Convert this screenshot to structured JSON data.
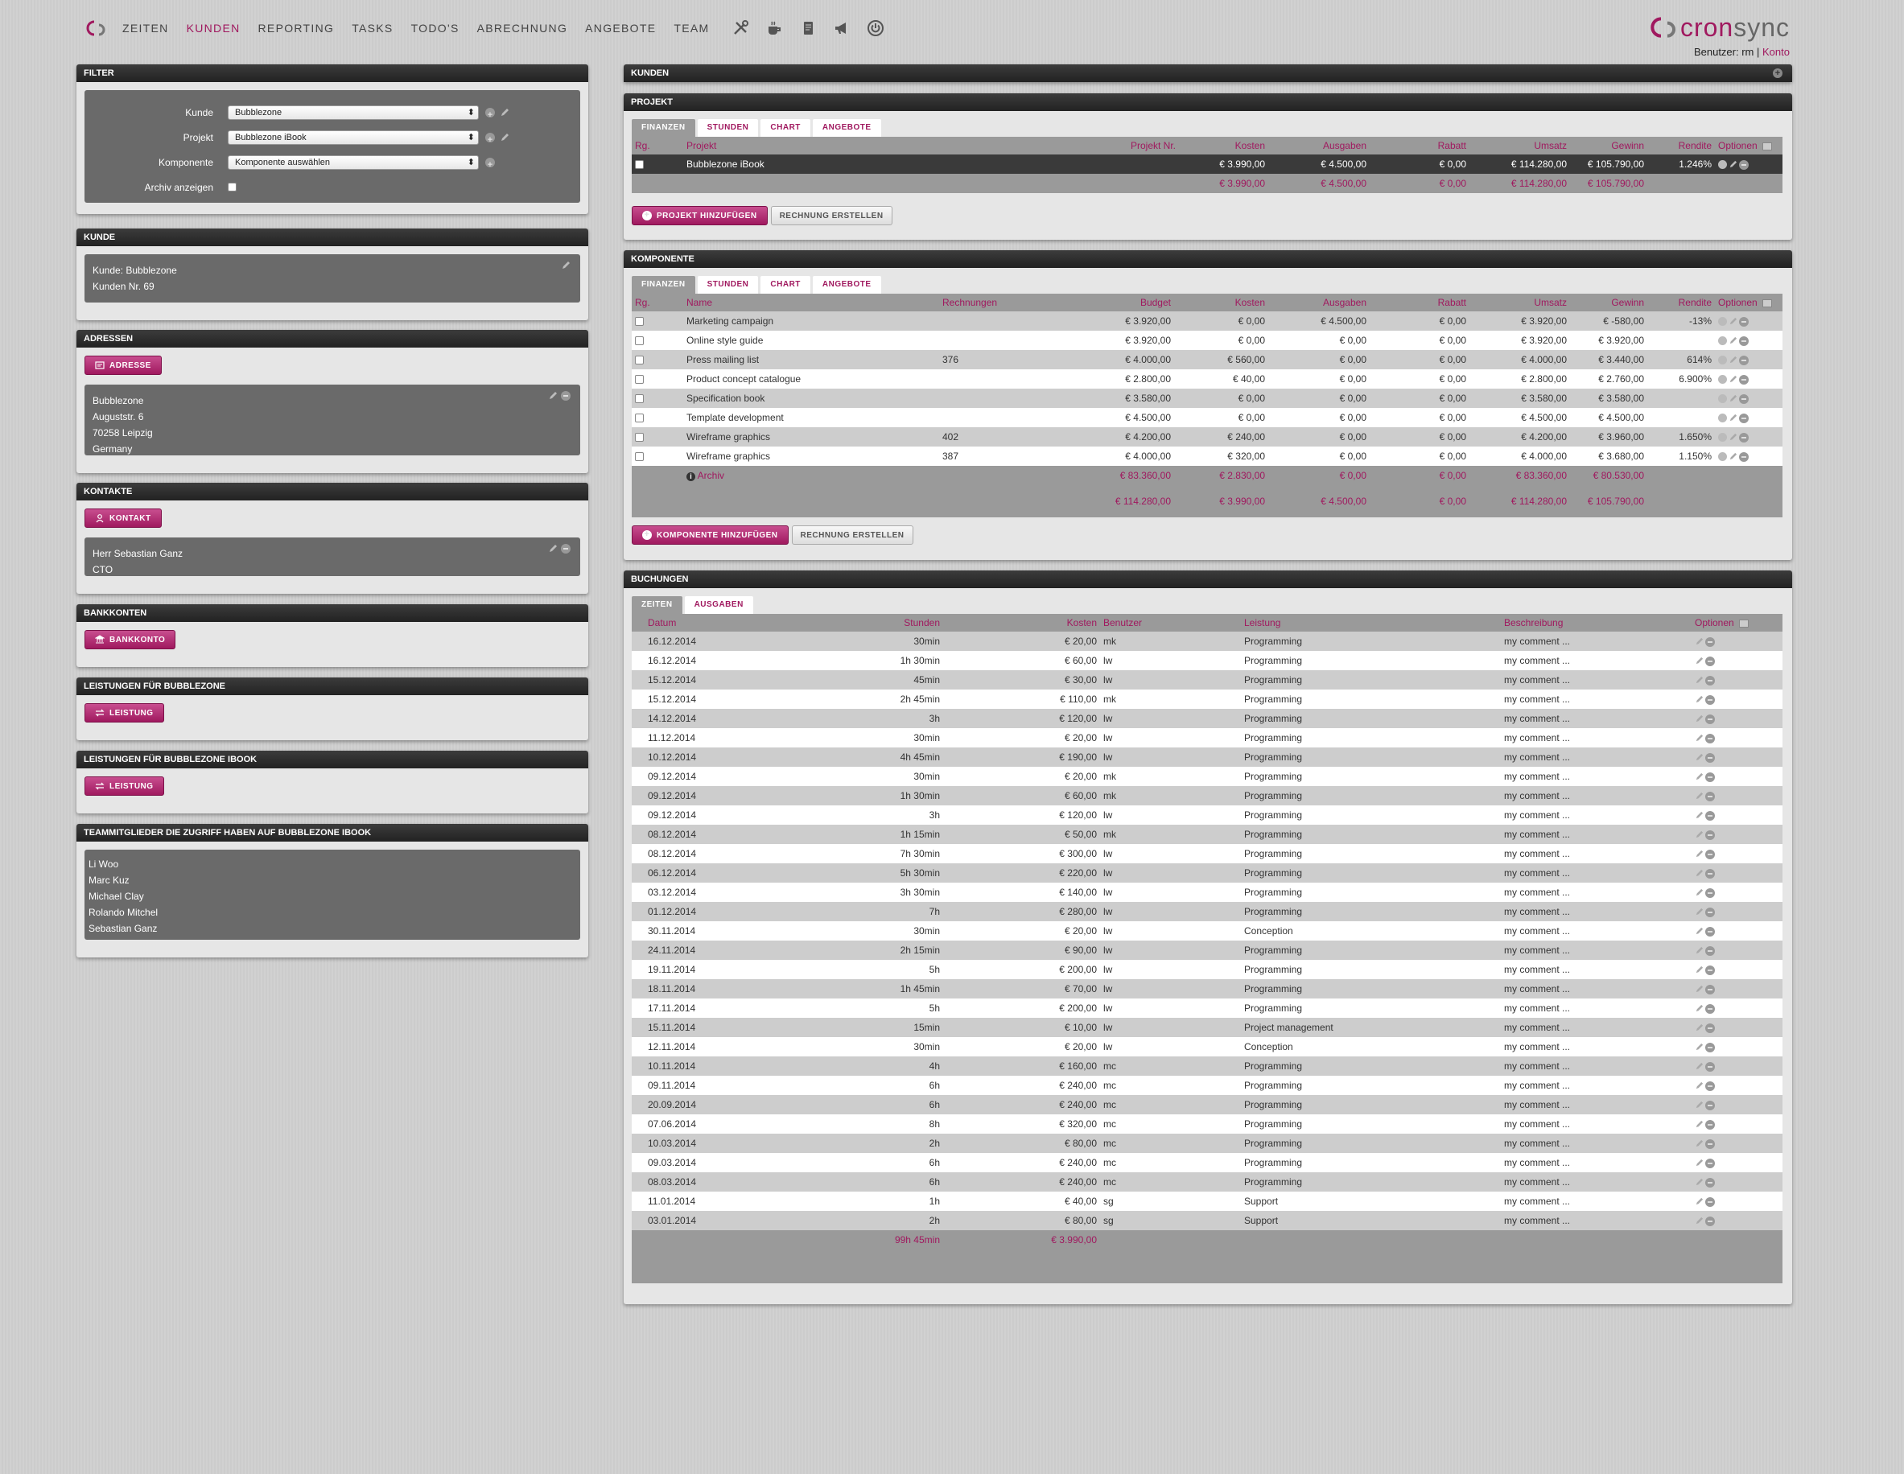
{
  "nav": {
    "items": [
      "ZEITEN",
      "KUNDEN",
      "REPORTING",
      "TASKS",
      "TODO'S",
      "ABRECHNUNG",
      "ANGEBOTE",
      "TEAM"
    ],
    "active": "KUNDEN",
    "icons": [
      "tools-icon",
      "coffee-icon",
      "document-icon",
      "megaphone-icon",
      "power-icon"
    ]
  },
  "brand": {
    "cron": "cron",
    "sync": "sync"
  },
  "user": {
    "label": "Benutzer: rm",
    "sep": "|",
    "account": "Konto"
  },
  "colors": {
    "accent": "#a0195f",
    "header": "#2c2c2c",
    "panel": "#e6e6e6"
  },
  "filter": {
    "title": "FILTER",
    "kunde_label": "Kunde",
    "kunde_value": "Bubblezone",
    "projekt_label": "Projekt",
    "projekt_value": "Bubblezone iBook",
    "komponente_label": "Komponente",
    "komponente_value": "Komponente auswählen",
    "archiv_label": "Archiv anzeigen"
  },
  "kunde": {
    "title": "KUNDE",
    "line1": "Kunde: Bubblezone",
    "line2": "Kunden Nr. 69"
  },
  "adressen": {
    "title": "ADRESSEN",
    "button": "ADRESSE",
    "lines": [
      "Bubblezone",
      "Auguststr. 6",
      "70258 Leipzig",
      "Germany"
    ]
  },
  "kontakte": {
    "title": "KONTAKTE",
    "button": "KONTAKT",
    "lines": [
      "Herr Sebastian Ganz",
      "CTO"
    ]
  },
  "bankkonten": {
    "title": "BANKKONTEN",
    "button": "BANKKONTO"
  },
  "leistungen1": {
    "title": "LEISTUNGEN FÜR BUBBLEZONE",
    "button": "LEISTUNG"
  },
  "leistungen2": {
    "title": "LEISTUNGEN FÜR BUBBLEZONE IBOOK",
    "button": "LEISTUNG"
  },
  "team": {
    "title": "TEAMMITGLIEDER DIE ZUGRIFF HABEN AUF BUBBLEZONE IBOOK",
    "members": [
      "Li Woo",
      "Marc Kuz",
      "Michael Clay",
      "Rolando Mitchel",
      "Sebastian Ganz"
    ]
  },
  "kunden_panel": {
    "title": "KUNDEN"
  },
  "projekt": {
    "title": "PROJEKT",
    "tabs": [
      "FINANZEN",
      "STUNDEN",
      "CHART",
      "ANGEBOTE"
    ],
    "headers": [
      "Rg.",
      "Projekt",
      "Projekt Nr.",
      "Kosten",
      "Ausgaben",
      "Rabatt",
      "Umsatz",
      "Gewinn",
      "Rendite",
      "Optionen"
    ],
    "row": {
      "name": "Bubblezone iBook",
      "nr": "",
      "kosten": "€ 3.990,00",
      "ausgaben": "€ 4.500,00",
      "rabatt": "€ 0,00",
      "umsatz": "€ 114.280,00",
      "gewinn": "€ 105.790,00",
      "rendite": "1.246%"
    },
    "sum": {
      "kosten": "€ 3.990,00",
      "ausgaben": "€ 4.500,00",
      "rabatt": "€ 0,00",
      "umsatz": "€ 114.280,00",
      "gewinn": "€ 105.790,00"
    },
    "add_button": "PROJEKT HINZUFÜGEN",
    "invoice_button": "RECHNUNG ERSTELLEN"
  },
  "komponente": {
    "title": "KOMPONENTE",
    "tabs": [
      "FINANZEN",
      "STUNDEN",
      "CHART",
      "ANGEBOTE"
    ],
    "headers": [
      "Rg.",
      "Name",
      "Rechnungen",
      "Budget",
      "Kosten",
      "Ausgaben",
      "Rabatt",
      "Umsatz",
      "Gewinn",
      "Rendite",
      "Optionen"
    ],
    "rows": [
      {
        "name": "Marketing campaign",
        "rech": "",
        "budget": "€ 3.920,00",
        "kosten": "€ 0,00",
        "ausgaben": "€ 4.500,00",
        "rabatt": "€ 0,00",
        "umsatz": "€ 3.920,00",
        "gewinn": "€ -580,00",
        "rendite": "-13%"
      },
      {
        "name": "Online style guide",
        "rech": "",
        "budget": "€ 3.920,00",
        "kosten": "€ 0,00",
        "ausgaben": "€ 0,00",
        "rabatt": "€ 0,00",
        "umsatz": "€ 3.920,00",
        "gewinn": "€ 3.920,00",
        "rendite": ""
      },
      {
        "name": "Press mailing list",
        "rech": "376",
        "budget": "€ 4.000,00",
        "kosten": "€ 560,00",
        "ausgaben": "€ 0,00",
        "rabatt": "€ 0,00",
        "umsatz": "€ 4.000,00",
        "gewinn": "€ 3.440,00",
        "rendite": "614%"
      },
      {
        "name": "Product concept catalogue",
        "rech": "",
        "budget": "€ 2.800,00",
        "kosten": "€ 40,00",
        "ausgaben": "€ 0,00",
        "rabatt": "€ 0,00",
        "umsatz": "€ 2.800,00",
        "gewinn": "€ 2.760,00",
        "rendite": "6.900%"
      },
      {
        "name": "Specification book",
        "rech": "",
        "budget": "€ 3.580,00",
        "kosten": "€ 0,00",
        "ausgaben": "€ 0,00",
        "rabatt": "€ 0,00",
        "umsatz": "€ 3.580,00",
        "gewinn": "€ 3.580,00",
        "rendite": ""
      },
      {
        "name": "Template development",
        "rech": "",
        "budget": "€ 4.500,00",
        "kosten": "€ 0,00",
        "ausgaben": "€ 0,00",
        "rabatt": "€ 0,00",
        "umsatz": "€ 4.500,00",
        "gewinn": "€ 4.500,00",
        "rendite": ""
      },
      {
        "name": "Wireframe graphics",
        "rech": "402",
        "budget": "€ 4.200,00",
        "kosten": "€ 240,00",
        "ausgaben": "€ 0,00",
        "rabatt": "€ 0,00",
        "umsatz": "€ 4.200,00",
        "gewinn": "€ 3.960,00",
        "rendite": "1.650%"
      },
      {
        "name": "Wireframe graphics",
        "rech": "387",
        "budget": "€ 4.000,00",
        "kosten": "€ 320,00",
        "ausgaben": "€ 0,00",
        "rabatt": "€ 0,00",
        "umsatz": "€ 4.000,00",
        "gewinn": "€ 3.680,00",
        "rendite": "1.150%"
      }
    ],
    "archiv_label": "Archiv",
    "sum1": {
      "budget": "€ 83.360,00",
      "kosten": "€ 2.830,00",
      "ausgaben": "€ 0,00",
      "rabatt": "€ 0,00",
      "umsatz": "€ 83.360,00",
      "gewinn": "€ 80.530,00"
    },
    "sum2": {
      "budget": "€ 114.280,00",
      "kosten": "€ 3.990,00",
      "ausgaben": "€ 4.500,00",
      "rabatt": "€ 0,00",
      "umsatz": "€ 114.280,00",
      "gewinn": "€ 105.790,00"
    },
    "add_button": "KOMPONENTE HINZUFÜGEN",
    "invoice_button": "RECHNUNG ERSTELLEN"
  },
  "buchungen": {
    "title": "BUCHUNGEN",
    "tabs": [
      "ZEITEN",
      "AUSGABEN"
    ],
    "headers": [
      "Datum",
      "Stunden",
      "Kosten",
      "Benutzer",
      "Leistung",
      "Beschreibung",
      "Optionen"
    ],
    "rows": [
      [
        "16.12.2014",
        "30min",
        "€ 20,00",
        "mk",
        "Programming",
        "my comment ..."
      ],
      [
        "16.12.2014",
        "1h 30min",
        "€ 60,00",
        "lw",
        "Programming",
        "my comment ..."
      ],
      [
        "15.12.2014",
        "45min",
        "€ 30,00",
        "lw",
        "Programming",
        "my comment ..."
      ],
      [
        "15.12.2014",
        "2h 45min",
        "€ 110,00",
        "mk",
        "Programming",
        "my comment ..."
      ],
      [
        "14.12.2014",
        "3h",
        "€ 120,00",
        "lw",
        "Programming",
        "my comment ..."
      ],
      [
        "11.12.2014",
        "30min",
        "€ 20,00",
        "lw",
        "Programming",
        "my comment ..."
      ],
      [
        "10.12.2014",
        "4h 45min",
        "€ 190,00",
        "lw",
        "Programming",
        "my comment ..."
      ],
      [
        "09.12.2014",
        "30min",
        "€ 20,00",
        "mk",
        "Programming",
        "my comment ..."
      ],
      [
        "09.12.2014",
        "1h 30min",
        "€ 60,00",
        "mk",
        "Programming",
        "my comment ..."
      ],
      [
        "09.12.2014",
        "3h",
        "€ 120,00",
        "lw",
        "Programming",
        "my comment ..."
      ],
      [
        "08.12.2014",
        "1h 15min",
        "€ 50,00",
        "mk",
        "Programming",
        "my comment ..."
      ],
      [
        "08.12.2014",
        "7h 30min",
        "€ 300,00",
        "lw",
        "Programming",
        "my comment ..."
      ],
      [
        "06.12.2014",
        "5h 30min",
        "€ 220,00",
        "lw",
        "Programming",
        "my comment ..."
      ],
      [
        "03.12.2014",
        "3h 30min",
        "€ 140,00",
        "lw",
        "Programming",
        "my comment ..."
      ],
      [
        "01.12.2014",
        "7h",
        "€ 280,00",
        "lw",
        "Programming",
        "my comment ..."
      ],
      [
        "30.11.2014",
        "30min",
        "€ 20,00",
        "lw",
        "Conception",
        "my comment ..."
      ],
      [
        "24.11.2014",
        "2h 15min",
        "€ 90,00",
        "lw",
        "Programming",
        "my comment ..."
      ],
      [
        "19.11.2014",
        "5h",
        "€ 200,00",
        "lw",
        "Programming",
        "my comment ..."
      ],
      [
        "18.11.2014",
        "1h 45min",
        "€ 70,00",
        "lw",
        "Programming",
        "my comment ..."
      ],
      [
        "17.11.2014",
        "5h",
        "€ 200,00",
        "lw",
        "Programming",
        "my comment ..."
      ],
      [
        "15.11.2014",
        "15min",
        "€ 10,00",
        "lw",
        "Project management",
        "my comment ..."
      ],
      [
        "12.11.2014",
        "30min",
        "€ 20,00",
        "lw",
        "Conception",
        "my comment ..."
      ],
      [
        "10.11.2014",
        "4h",
        "€ 160,00",
        "mc",
        "Programming",
        "my comment ..."
      ],
      [
        "09.11.2014",
        "6h",
        "€ 240,00",
        "mc",
        "Programming",
        "my comment ..."
      ],
      [
        "20.09.2014",
        "6h",
        "€ 240,00",
        "mc",
        "Programming",
        "my comment ..."
      ],
      [
        "07.06.2014",
        "8h",
        "€ 320,00",
        "mc",
        "Programming",
        "my comment ..."
      ],
      [
        "10.03.2014",
        "2h",
        "€ 80,00",
        "mc",
        "Programming",
        "my comment ..."
      ],
      [
        "09.03.2014",
        "6h",
        "€ 240,00",
        "mc",
        "Programming",
        "my comment ..."
      ],
      [
        "08.03.2014",
        "6h",
        "€ 240,00",
        "mc",
        "Programming",
        "my comment ..."
      ],
      [
        "11.01.2014",
        "1h",
        "€ 40,00",
        "sg",
        "Support",
        "my comment ..."
      ],
      [
        "03.01.2014",
        "2h",
        "€ 80,00",
        "sg",
        "Support",
        "my comment ..."
      ]
    ],
    "sum_hours": "99h 45min",
    "sum_cost": "€ 3.990,00"
  }
}
